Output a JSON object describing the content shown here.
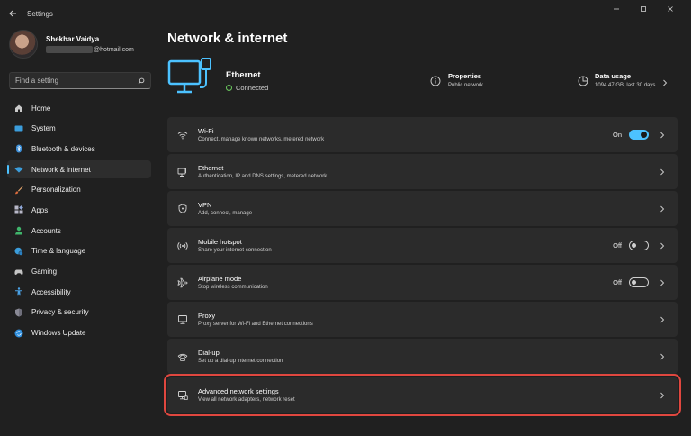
{
  "window": {
    "title": "Settings"
  },
  "profile": {
    "name": "Shekhar Vaidya",
    "email_suffix": "@hotmail.com"
  },
  "search": {
    "placeholder": "Find a setting"
  },
  "sidebar": {
    "items": [
      {
        "label": "Home",
        "icon": "home-icon"
      },
      {
        "label": "System",
        "icon": "monitor-icon"
      },
      {
        "label": "Bluetooth & devices",
        "icon": "bluetooth-icon"
      },
      {
        "label": "Network & internet",
        "icon": "wifi-icon",
        "active": true
      },
      {
        "label": "Personalization",
        "icon": "brush-icon"
      },
      {
        "label": "Apps",
        "icon": "apps-icon"
      },
      {
        "label": "Accounts",
        "icon": "account-icon"
      },
      {
        "label": "Time & language",
        "icon": "globe-clock-icon"
      },
      {
        "label": "Gaming",
        "icon": "gamepad-icon"
      },
      {
        "label": "Accessibility",
        "icon": "accessibility-icon"
      },
      {
        "label": "Privacy & security",
        "icon": "shield-icon"
      },
      {
        "label": "Windows Update",
        "icon": "update-icon"
      }
    ]
  },
  "main": {
    "title": "Network & internet",
    "hero": {
      "name": "Ethernet",
      "status": "Connected",
      "properties_title": "Properties",
      "properties_sub": "Public network",
      "usage_title": "Data usage",
      "usage_sub": "1094.47 GB, last 30 days"
    },
    "cards": [
      {
        "title": "Wi-Fi",
        "sub": "Connect, manage known networks, metered network",
        "icon": "wifi-icon",
        "toggle": "On"
      },
      {
        "title": "Ethernet",
        "sub": "Authentication, IP and DNS settings, metered network",
        "icon": "ethernet-icon"
      },
      {
        "title": "VPN",
        "sub": "Add, connect, manage",
        "icon": "vpn-shield-icon"
      },
      {
        "title": "Mobile hotspot",
        "sub": "Share your internet connection",
        "icon": "hotspot-icon",
        "toggle": "Off"
      },
      {
        "title": "Airplane mode",
        "sub": "Stop wireless communication",
        "icon": "airplane-icon",
        "toggle": "Off"
      },
      {
        "title": "Proxy",
        "sub": "Proxy server for Wi-Fi and Ethernet connections",
        "icon": "proxy-icon"
      },
      {
        "title": "Dial-up",
        "sub": "Set up a dial-up internet connection",
        "icon": "dialup-icon"
      },
      {
        "title": "Advanced network settings",
        "sub": "View all network adapters, network reset",
        "icon": "advanced-network-icon"
      }
    ]
  },
  "colors": {
    "accent": "#4cc2ff",
    "highlight": "#e0473f",
    "background": "#202020",
    "card": "#2b2b2b"
  }
}
